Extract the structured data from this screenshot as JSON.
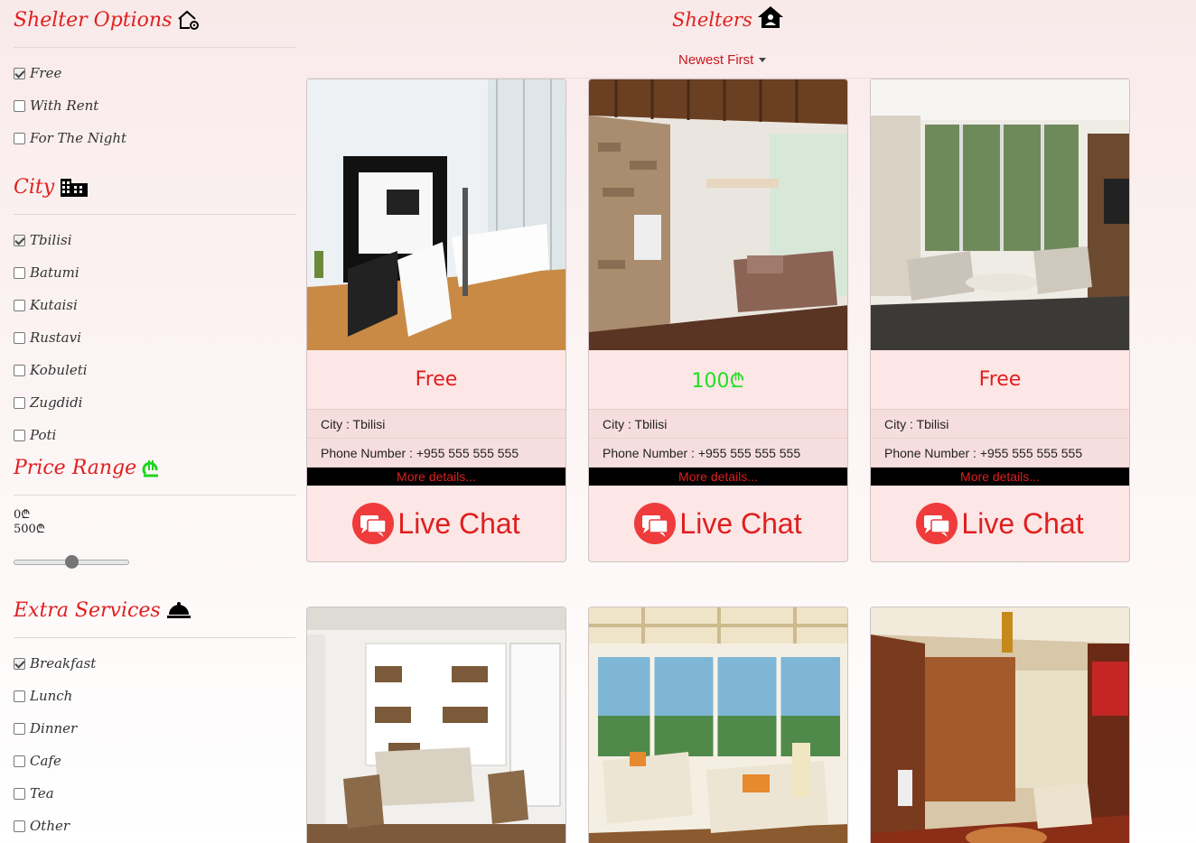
{
  "sidebar": {
    "shelter_options": {
      "title": "Shelter Options",
      "icon": "house-gear-icon",
      "items": [
        {
          "label": "Free",
          "checked": true
        },
        {
          "label": "With Rent",
          "checked": false
        },
        {
          "label": "For The Night",
          "checked": false
        }
      ]
    },
    "city": {
      "title": "City",
      "icon": "city-buildings-icon",
      "items": [
        {
          "label": "Tbilisi",
          "checked": true
        },
        {
          "label": "Batumi",
          "checked": false
        },
        {
          "label": "Kutaisi",
          "checked": false
        },
        {
          "label": "Rustavi",
          "checked": false
        },
        {
          "label": "Kobuleti",
          "checked": false
        },
        {
          "label": "Zugdidi",
          "checked": false
        },
        {
          "label": "Poti",
          "checked": false
        }
      ]
    },
    "price_range": {
      "title": "Price Range",
      "icon": "lari-currency-icon",
      "min_label": "0₾",
      "max_label": "500₾",
      "slider_value_fraction": 0.5
    },
    "extra_services": {
      "title": "Extra Services",
      "icon": "service-bell-icon",
      "items": [
        {
          "label": "Breakfast",
          "checked": true
        },
        {
          "label": "Lunch",
          "checked": false
        },
        {
          "label": "Dinner",
          "checked": false
        },
        {
          "label": "Cafe",
          "checked": false
        },
        {
          "label": "Tea",
          "checked": false
        },
        {
          "label": "Other",
          "checked": false
        }
      ]
    }
  },
  "header": {
    "title": "Shelters",
    "icon": "house-user-icon",
    "sort_label": "Newest First"
  },
  "cards": [
    {
      "price": "Free",
      "price_color": "#e01f1f",
      "city": "City : Tbilisi",
      "phone": "Phone Number : +955 555 555 555",
      "more": "More details...",
      "chat": "Live Chat",
      "image": "living-room-white-sofas-photo"
    },
    {
      "price": "100₾",
      "price_color": "#22e022",
      "city": "City : Tbilisi",
      "phone": "Phone Number : +955 555 555 555",
      "more": "More details...",
      "chat": "Live Chat",
      "image": "living-room-stone-wall-photo"
    },
    {
      "price": "Free",
      "price_color": "#e01f1f",
      "city": "City : Tbilisi",
      "phone": "Phone Number : +955 555 555 555",
      "more": "More details...",
      "chat": "Live Chat",
      "image": "living-room-glass-doors-photo"
    },
    {
      "image": "living-room-bookshelf-photo"
    },
    {
      "image": "living-room-lake-view-photo"
    },
    {
      "image": "living-room-chinese-style-photo"
    }
  ],
  "colors": {
    "accent": "#e01f1f",
    "price_paid": "#22e022",
    "card_bg": "#fce6e6",
    "more_bar": "#000000"
  }
}
